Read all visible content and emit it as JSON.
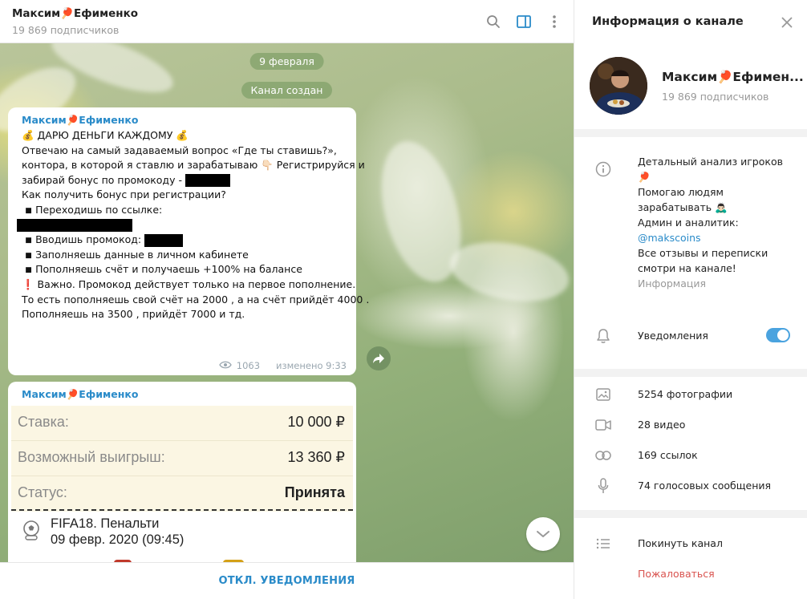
{
  "chat": {
    "title": "Максим🏓Ефименко",
    "subscribers": "19 869 подписчиков",
    "date_pill": "9 февраля",
    "service_pill": "Канал создан",
    "bottom_button": "ОТКЛ. УВЕДОМЛЕНИЯ"
  },
  "post1": {
    "author": "Максим🏓Ефименко",
    "lines": [
      "💰 ДАРЮ ДЕНЬГИ КАЖДОМУ 💰",
      "",
      "Отвечаю на самый задаваемый вопрос «Где ты ставишь?»,",
      "контора, в которой я ставлю и зарабатываю 👇🏻 Регистрируйся и",
      "забирай бонус по промокоду -",
      "",
      "Как получить бонус при регистрации?",
      " ◾ Переходишь по ссылке:",
      "",
      " ◾ Вводишь промокод:",
      " ◾ Заполняешь данные в личном кабинете",
      " ◾ Пополняешь счёт и получаешь +100% на балансе",
      "",
      "❗ Важно. Промокод действует только на первое пополнение.",
      "То есть пополняешь свой счёт на 2000 , а на счёт прийдёт 4000 .",
      "Пополняешь на 3500 , прийдёт 7000 и тд."
    ],
    "views": "1063",
    "edited": "изменено 9:33"
  },
  "post2": {
    "author": "Максим🏓Ефименко",
    "rows": [
      {
        "label": "Ставка:",
        "value": "10 000 ₽"
      },
      {
        "label": "Возможный выигрыш:",
        "value": "13 360 ₽"
      },
      {
        "label": "Статус:",
        "value": "Принята"
      }
    ],
    "event_title": "FIFA18. Пенальти",
    "event_date": "09 февр. 2020 (09:45)"
  },
  "info": {
    "title": "Информация о канале",
    "name": "Максим🏓Ефимен...",
    "subscribers": "19 869 подписчиков",
    "about_lines": [
      "Детальный анализ игроков",
      "🏓",
      "Помогаю людям",
      "зарабатывать 🙇🏻‍♂️",
      "Админ и аналитик:",
      "@makscoins",
      "Все отзывы и переписки",
      "смотри на канале!"
    ],
    "about_caption": "Информация",
    "notifications_label": "Уведомления",
    "notifications_on": true,
    "media": [
      {
        "label": "5254 фотографии",
        "icon": "photo-icon"
      },
      {
        "label": "28 видео",
        "icon": "video-icon"
      },
      {
        "label": "169 ссылок",
        "icon": "link-icon"
      },
      {
        "label": "74 голосовых сообщения",
        "icon": "microphone-icon"
      }
    ],
    "leave_label": "Покинуть канал",
    "report_label": "Пожаловаться"
  },
  "colors": {
    "accent": "#2a8bc9",
    "report": "#d9534f",
    "toggle": "#4aa3df"
  }
}
